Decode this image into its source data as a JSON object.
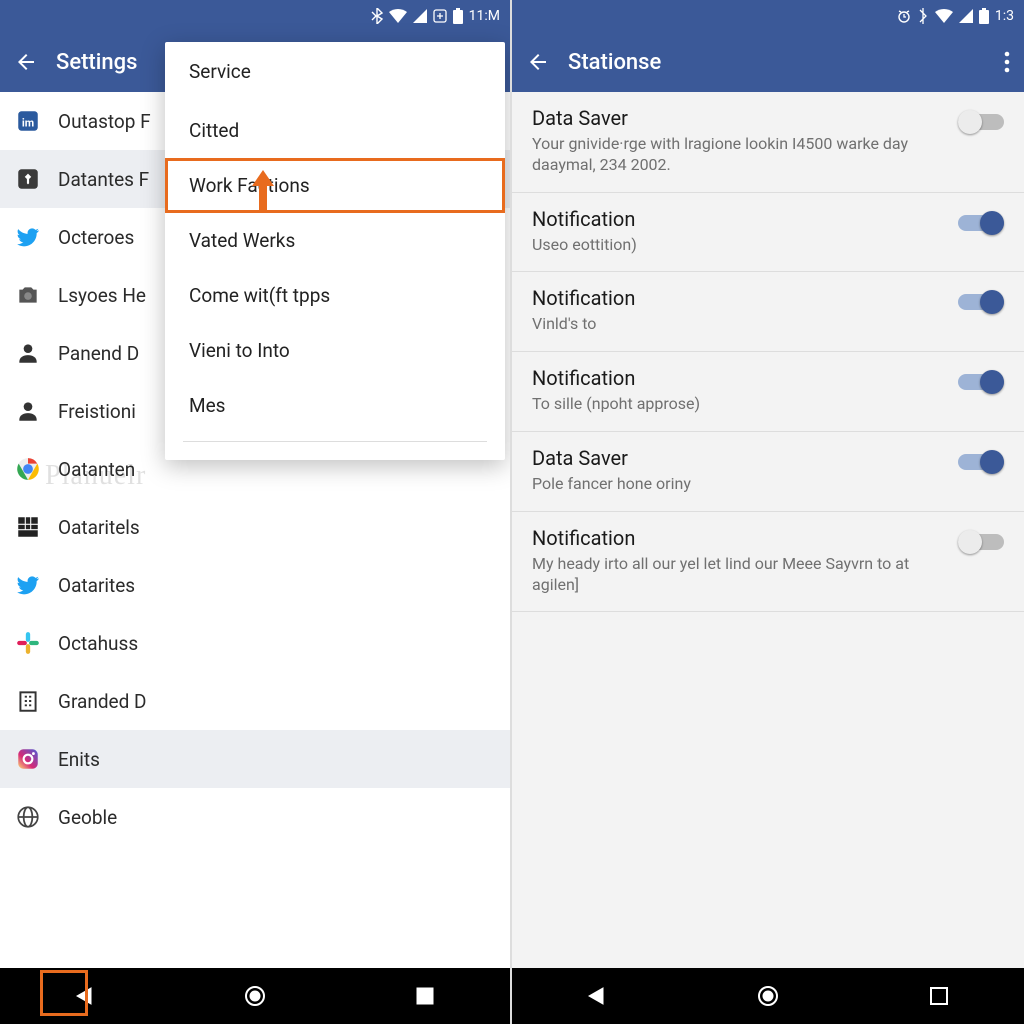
{
  "left": {
    "status": {
      "time": "11:M"
    },
    "appbar": {
      "title": "Settings"
    },
    "list": [
      {
        "icon": "doc-blue",
        "label": "Outastop F"
      },
      {
        "icon": "pin-dark",
        "label": "Datantes F",
        "selected": true
      },
      {
        "icon": "twitter",
        "label": "Octeroes"
      },
      {
        "icon": "camera-grey",
        "label": "Lsyoes He"
      },
      {
        "icon": "person-dark",
        "label": "Panend D"
      },
      {
        "icon": "person-dark",
        "label": "Freistioni"
      },
      {
        "icon": "chrome",
        "label": "Oatanten"
      },
      {
        "icon": "grid-dark",
        "label": "Oataritels"
      },
      {
        "icon": "twitter",
        "label": "Oatarites"
      },
      {
        "icon": "slack",
        "label": "Octahuss"
      },
      {
        "icon": "building",
        "label": "Granded D"
      },
      {
        "icon": "instagram",
        "label": "Enits",
        "selected": true
      },
      {
        "icon": "globe",
        "label": "Geoble"
      }
    ],
    "popup": {
      "header": "Service",
      "items": [
        {
          "label": "Citted"
        },
        {
          "label": "Work Factions",
          "highlighted": true
        },
        {
          "label": "Vated Werks"
        },
        {
          "label": "Come wit(ft tpps"
        },
        {
          "label": "Vieni to Into"
        },
        {
          "label": "Mes"
        }
      ]
    },
    "watermark": "Planuelr"
  },
  "right": {
    "status": {
      "time": "1:3"
    },
    "appbar": {
      "title": "Stationse"
    },
    "settings": [
      {
        "title": "Data Saver",
        "sub": "Your gnivide·rge  with lragione lookin I4500 warke day daaymal, 234 2002.",
        "on": false
      },
      {
        "title": "Notification",
        "sub": "Useo eottition)",
        "on": true
      },
      {
        "title": "Notification",
        "sub": "Vinld's to",
        "on": true
      },
      {
        "title": "Notification",
        "sub": "To sille (npoht approse)",
        "on": true
      },
      {
        "title": "Data Saver",
        "sub": "Pole fancer hone oriny",
        "on": true
      },
      {
        "title": "Notification",
        "sub": "My heady irto all our yel let lind our Meee Sayvrn to at agilen]",
        "on": false
      }
    ]
  }
}
